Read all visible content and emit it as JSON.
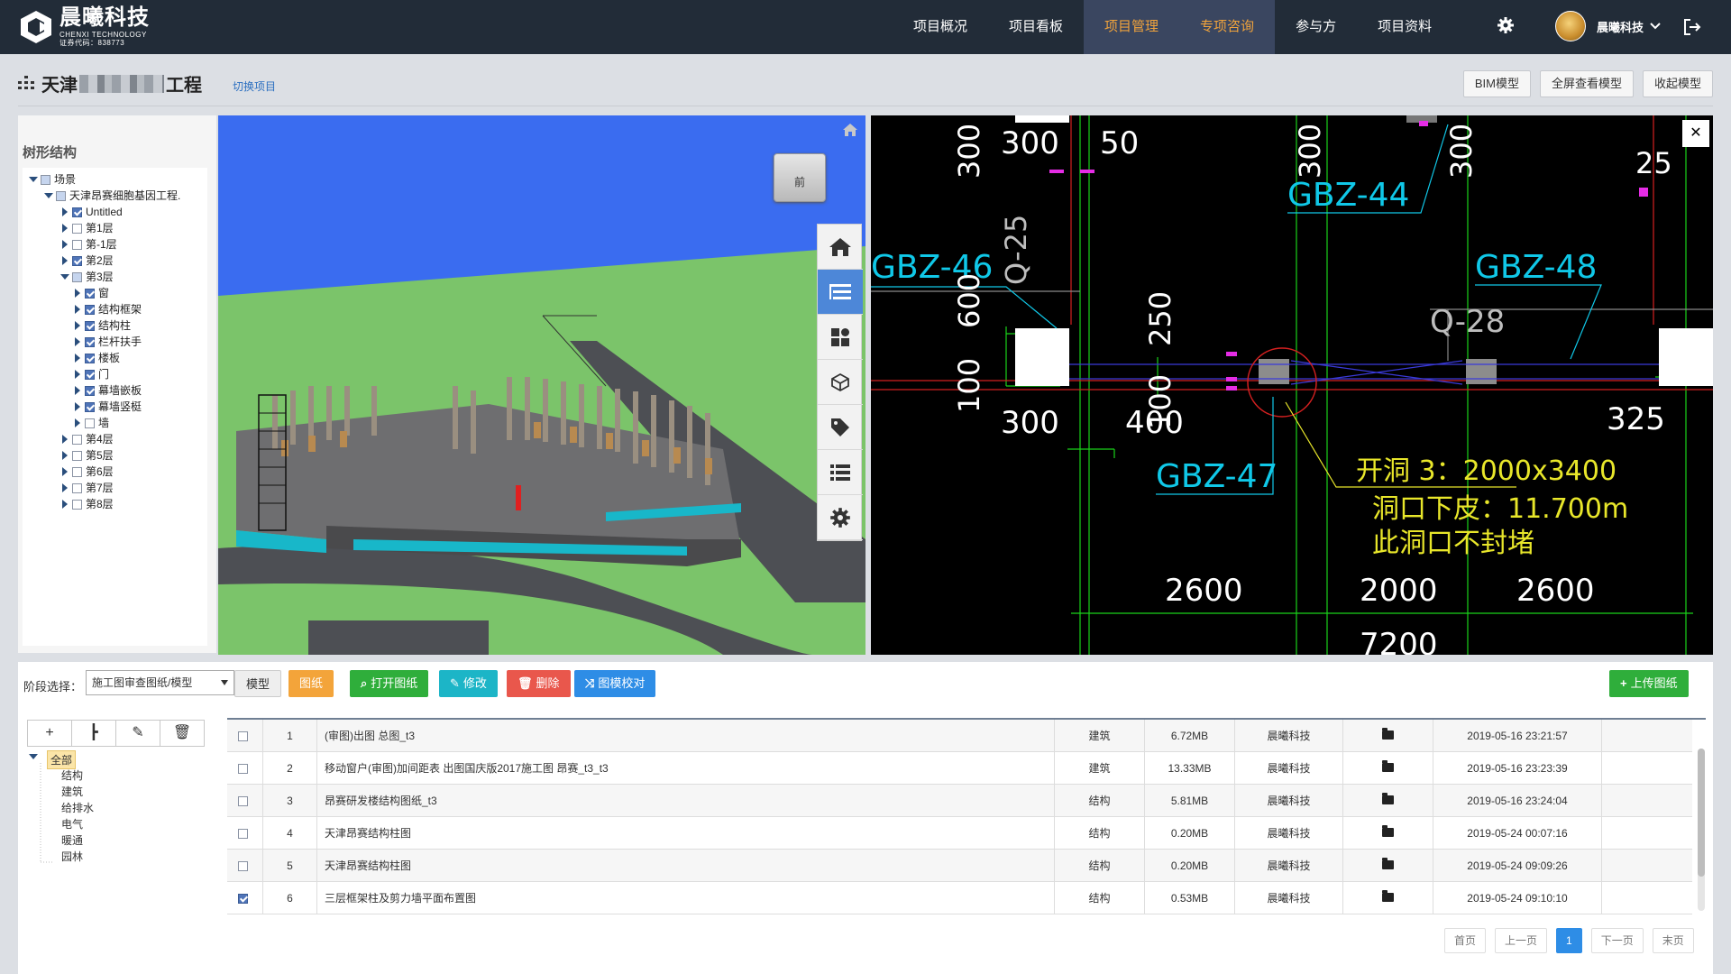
{
  "brand": {
    "name": "晨曦科技",
    "sub": "CHENXI TECHNOLOGY",
    "code": "证券代码：838773"
  },
  "nav": [
    {
      "label": "项目概况",
      "active": false
    },
    {
      "label": "项目看板",
      "active": false
    },
    {
      "label": "项目管理",
      "active": true
    },
    {
      "label": "专项咨询",
      "active": true
    },
    {
      "label": "参与方",
      "active": false
    },
    {
      "label": "项目资料",
      "active": false
    }
  ],
  "user": {
    "name": "晨曦科技"
  },
  "project": {
    "title_prefix": "天津",
    "title_suffix": "工程",
    "switch_label": "切换项目"
  },
  "header_buttons": [
    "BIM模型",
    "全屏查看模型",
    "收起模型"
  ],
  "tree": {
    "title": "树形结构",
    "nodes": [
      {
        "label": "场景",
        "level": 0,
        "toggle": "down",
        "check": "part"
      },
      {
        "label": "天津昂赛细胞基因工程.",
        "level": 1,
        "toggle": "down",
        "check": "part"
      },
      {
        "label": "Untitled",
        "level": 2,
        "toggle": "right",
        "check": "on"
      },
      {
        "label": "第1层",
        "level": 2,
        "toggle": "right",
        "check": "off"
      },
      {
        "label": "第-1层",
        "level": 2,
        "toggle": "right",
        "check": "off"
      },
      {
        "label": "第2层",
        "level": 2,
        "toggle": "right",
        "check": "on"
      },
      {
        "label": "第3层",
        "level": 2,
        "toggle": "down",
        "check": "part"
      },
      {
        "label": "窗",
        "level": 3,
        "toggle": "right",
        "check": "on"
      },
      {
        "label": "结构框架",
        "level": 3,
        "toggle": "right",
        "check": "on"
      },
      {
        "label": "结构柱",
        "level": 3,
        "toggle": "right",
        "check": "on"
      },
      {
        "label": "栏杆扶手",
        "level": 3,
        "toggle": "right",
        "check": "on"
      },
      {
        "label": "楼板",
        "level": 3,
        "toggle": "right",
        "check": "on"
      },
      {
        "label": "门",
        "level": 3,
        "toggle": "right",
        "check": "on"
      },
      {
        "label": "幕墙嵌板",
        "level": 3,
        "toggle": "right",
        "check": "on"
      },
      {
        "label": "幕墙竖梃",
        "level": 3,
        "toggle": "right",
        "check": "on"
      },
      {
        "label": "墙",
        "level": 3,
        "toggle": "right",
        "check": "off"
      },
      {
        "label": "第4层",
        "level": 2,
        "toggle": "right",
        "check": "off"
      },
      {
        "label": "第5层",
        "level": 2,
        "toggle": "right",
        "check": "off"
      },
      {
        "label": "第6层",
        "level": 2,
        "toggle": "right",
        "check": "off"
      },
      {
        "label": "第7层",
        "level": 2,
        "toggle": "right",
        "check": "off"
      },
      {
        "label": "第8层",
        "level": 2,
        "toggle": "right",
        "check": "off"
      }
    ]
  },
  "viewcube": {
    "label": "前"
  },
  "viewer_tools": [
    "home-icon",
    "layers-icon",
    "components-icon",
    "cube-icon",
    "tag-icon",
    "list-icon",
    "settings-icon"
  ],
  "cad": {
    "labels": [
      "GBZ-44",
      "GBZ-46",
      "GBZ-48",
      "GBZ-47",
      "Q-25",
      "Q-28"
    ],
    "dims": [
      "300",
      "50",
      "300",
      "300",
      "25",
      "600",
      "100",
      "250",
      "100",
      "300",
      "400",
      "325",
      "2600",
      "2000",
      "2600",
      "7200"
    ],
    "note1": "开洞 3：2000x3400",
    "note2": "洞口下皮：11.700m",
    "note3": "此洞口不封堵"
  },
  "toolbar": {
    "stage_label": "阶段选择：",
    "stage_value": "施工图审查图纸/模型",
    "model": "模型",
    "drawing": "图纸",
    "open": "打开图纸",
    "edit": "修改",
    "delete": "删除",
    "compare": "图模校对",
    "upload": "上传图纸"
  },
  "categories": {
    "root": "全部",
    "items": [
      "结构",
      "建筑",
      "给排水",
      "电气",
      "暖通",
      "园林"
    ]
  },
  "files": [
    {
      "no": "1",
      "name": "(审图)出图 总图_t3",
      "type": "建筑",
      "size": "6.72MB",
      "owner": "晨曦科技",
      "date": "2019-05-16 23:21:57",
      "checked": false
    },
    {
      "no": "2",
      "name": "移动窗户(审图)加间距表 出图国庆版2017施工图 昂赛_t3_t3",
      "type": "建筑",
      "size": "13.33MB",
      "owner": "晨曦科技",
      "date": "2019-05-16 23:23:39",
      "checked": false
    },
    {
      "no": "3",
      "name": "昂赛研发楼结构图纸_t3",
      "type": "结构",
      "size": "5.81MB",
      "owner": "晨曦科技",
      "date": "2019-05-16 23:24:04",
      "checked": false
    },
    {
      "no": "4",
      "name": "天津昂赛结构柱图",
      "type": "结构",
      "size": "0.20MB",
      "owner": "晨曦科技",
      "date": "2019-05-24 00:07:16",
      "checked": false
    },
    {
      "no": "5",
      "name": "天津昂赛结构柱图",
      "type": "结构",
      "size": "0.20MB",
      "owner": "晨曦科技",
      "date": "2019-05-24 09:09:26",
      "checked": false
    },
    {
      "no": "6",
      "name": "三层框架柱及剪力墙平面布置图",
      "type": "结构",
      "size": "0.53MB",
      "owner": "晨曦科技",
      "date": "2019-05-24 09:10:10",
      "checked": true
    }
  ],
  "pager": {
    "first": "首页",
    "prev": "上一页",
    "current": "1",
    "next": "下一页",
    "last": "末页"
  },
  "colors": {
    "topbar": "#222c38",
    "active_nav": "#f0a33c",
    "green": "#2fae3b",
    "orange": "#f3a43a",
    "teal": "#1cb5c7",
    "red": "#e9574c",
    "blue": "#2e8de6"
  }
}
